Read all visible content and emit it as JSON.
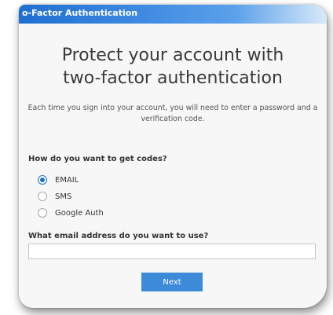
{
  "window": {
    "title": "o-Factor Authentication"
  },
  "main": {
    "heading_line1": "Protect your account with",
    "heading_line2": "two-factor authentication",
    "description_line1": "Each time you sign into your account, you will need to enter a password and a",
    "description_line2": "verification code."
  },
  "method": {
    "question": "How do you want to get codes?",
    "selected": "EMAIL",
    "options": [
      {
        "label": "EMAIL",
        "selected": true
      },
      {
        "label": "SMS",
        "selected": false
      },
      {
        "label": "Google Auth",
        "selected": false
      }
    ]
  },
  "email": {
    "label": "What email address do you want to use?",
    "value": ""
  },
  "actions": {
    "next_label": "Next"
  },
  "colors": {
    "accent": "#3d8bd8",
    "radio_selected": "#1a73c8",
    "titlebar": "#2a78d6"
  }
}
